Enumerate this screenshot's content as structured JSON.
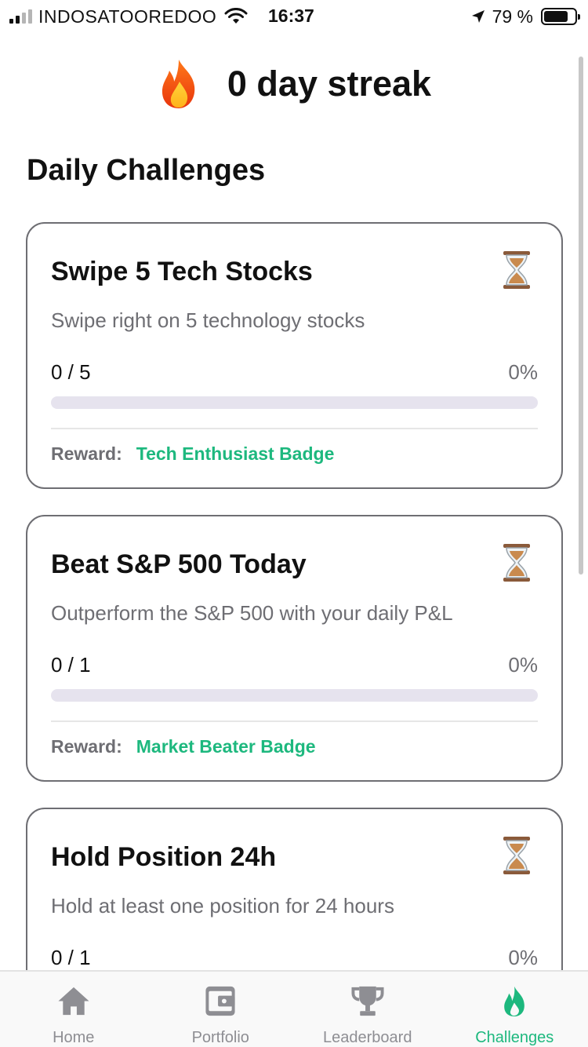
{
  "status_bar": {
    "carrier": "INDOSATOOREDOO",
    "time": "16:37",
    "battery_percent": "79 %",
    "battery_level": 0.79
  },
  "header": {
    "streak_text": "0 day streak",
    "icon": "fire-icon"
  },
  "section_title": "Daily Challenges",
  "challenges": [
    {
      "title": "Swipe 5 Tech Stocks",
      "description": "Swipe right on 5 technology stocks",
      "progress_text": "0 / 5",
      "percent_text": "0%",
      "progress": 0,
      "reward_label": "Reward:",
      "reward_value": "Tech Enthusiast Badge",
      "icon": "hourglass-icon"
    },
    {
      "title": "Beat S&P 500 Today",
      "description": "Outperform the S&P 500 with your daily P&L",
      "progress_text": "0 / 1",
      "percent_text": "0%",
      "progress": 0,
      "reward_label": "Reward:",
      "reward_value": "Market Beater Badge",
      "icon": "hourglass-icon"
    },
    {
      "title": "Hold Position 24h",
      "description": "Hold at least one position for 24 hours",
      "progress_text": "0 / 1",
      "percent_text": "0%",
      "progress": 0,
      "icon": "hourglass-icon"
    }
  ],
  "tabs": [
    {
      "label": "Home",
      "icon": "home-icon",
      "active": false
    },
    {
      "label": "Portfolio",
      "icon": "wallet-icon",
      "active": false
    },
    {
      "label": "Leaderboard",
      "icon": "trophy-icon",
      "active": false
    },
    {
      "label": "Challenges",
      "icon": "flame-icon",
      "active": true
    }
  ],
  "colors": {
    "accent": "#1db87e",
    "muted_text": "#6e6e73",
    "progress_track": "#e6e3ee",
    "inactive_tab": "#8e8e93"
  }
}
